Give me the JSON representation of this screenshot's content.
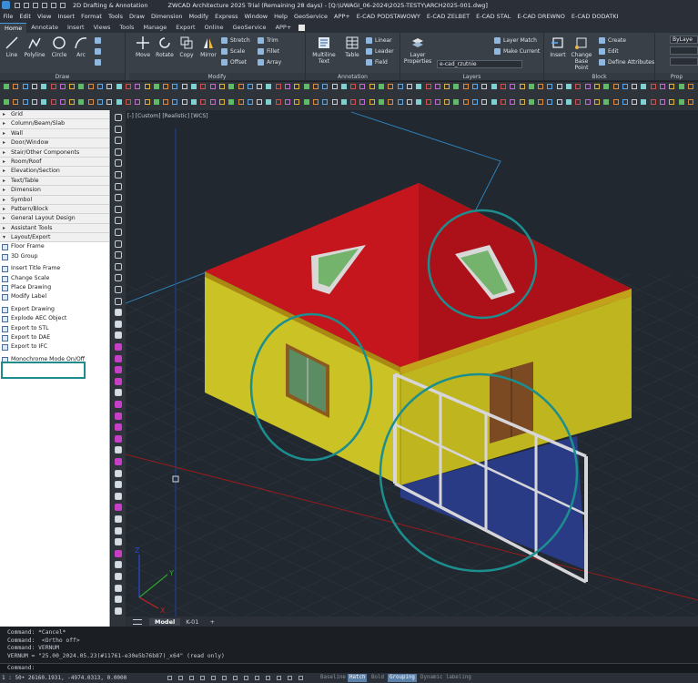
{
  "title_bar": {
    "workspace": "2D Drafting & Annotation",
    "title": "ZWCAD Architecture 2025 Trial (Remaining 28 days) - [Q:\\UWAGI_06-2024\\2025-TESTY\\ARCH2025-001.dwg]"
  },
  "menu": [
    "File",
    "Edit",
    "View",
    "Insert",
    "Format",
    "Tools",
    "Draw",
    "Dimension",
    "Modify",
    "Express",
    "Window",
    "Help",
    "GeoService",
    "APP+",
    "E-CAD PODSTAWOWY",
    "E-CAD ZELBET",
    "E-CAD STAL",
    "E-CAD DREWNO",
    "E-CAD DODATKI"
  ],
  "ribbon_tabs": [
    "Home",
    "Annotate",
    "Insert",
    "Views",
    "Tools",
    "Manage",
    "Export",
    "Online",
    "GeoService",
    "APP+"
  ],
  "ribbon": {
    "draw": {
      "title": "Draw",
      "line": "Line",
      "polyline": "Polyline",
      "circle": "Circle",
      "arc": "Arc"
    },
    "modify": {
      "title": "Modify",
      "move": "Move",
      "rotate": "Rotate",
      "copy": "Copy",
      "mirror": "Mirror",
      "stretch": "Stretch",
      "scale": "Scale",
      "offset": "Offset",
      "trim": "Trim",
      "fillet": "Fillet",
      "array": "Array"
    },
    "annotation": {
      "title": "Annotation",
      "mtext": "Multiline Text",
      "table": "Table",
      "linear": "Linear",
      "leader": "Leader",
      "field": "Field"
    },
    "layers": {
      "title": "Layers",
      "props": "Layer Properties",
      "match": "Layer Match",
      "current": "Make Current",
      "layer_name": "e-cad_rzutnie"
    },
    "block": {
      "title": "Block",
      "insert": "Insert",
      "base": "Change Base Point",
      "create": "Create",
      "edit": "Edit",
      "attrib": "Define Attributes"
    },
    "properties": {
      "title": "Prop",
      "bylayer": "ByLaye"
    }
  },
  "palette": {
    "categories": [
      "Grid",
      "Column/Beam/Slab",
      "Wall",
      "Door/Window",
      "Stair/Other Components",
      "Room/Roof",
      "Elevation/Section",
      "Text/Table",
      "Dimension",
      "Symbol",
      "Pattern/Block",
      "General Layout Design",
      "Assistant Tools",
      "Layout/Export"
    ],
    "group1": [
      "Floor Frame",
      "3D Group",
      "Insert Title Frame",
      "Change Scale",
      "Place Drawing",
      "Modify Label"
    ],
    "group2": [
      "Export Drawing",
      "Explode AEC Object",
      "Export to STL",
      "Export to DAE",
      "Export to IFC"
    ],
    "group3": [
      "Monochrome Mode On/Off"
    ]
  },
  "viewport": {
    "label": "[-] [Custom] [Realistic] [WCS]",
    "axis_x": "X",
    "axis_y": "Y",
    "axis_z": "Z",
    "colors": {
      "wall": "#cbc325",
      "roof": "#c5161d",
      "eave": "#a98914",
      "glass": "#2a3b86",
      "frame": "#d6d6da",
      "highlight": "#1c8e8e"
    }
  },
  "layout_tabs": [
    "Model",
    "K-01"
  ],
  "command": {
    "history": [
      "Command: *Cancel*",
      "Command:  <Ortho off>",
      "Command: VERNUM",
      "VERNUM = \"25.00_2024.05.23(#11761-e30e5b76b87)_x64\" (read only)"
    ],
    "prompt": "Command:"
  },
  "status": {
    "coords": "1 : 50•  26160.1931, -4974.0313, 0.0000",
    "toggles": [
      "Baseline",
      "Hatch",
      "Bold",
      "Grouping",
      "Dynamic labeling"
    ]
  }
}
